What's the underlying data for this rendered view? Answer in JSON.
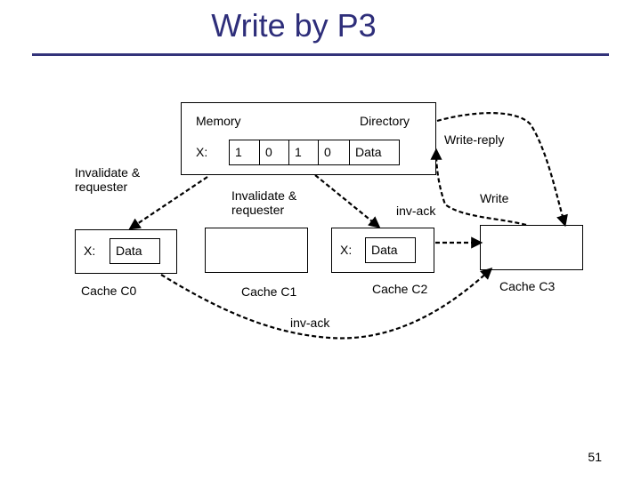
{
  "slide": {
    "title": "Write by P3",
    "page_number": "51",
    "title_color": "#2e2e7a",
    "rule_color": "#33337a"
  },
  "memory": {
    "label": "Memory",
    "directory_label": "Directory",
    "row_label": "X:",
    "directory_bits": [
      "1",
      "0",
      "1",
      "0"
    ],
    "data_label": "Data"
  },
  "caches": [
    {
      "name": "Cache C0",
      "row_label": "X:",
      "data_label": "Data"
    },
    {
      "name": "Cache C1"
    },
    {
      "name": "Cache C2",
      "row_label": "X:",
      "data_label": "Data"
    },
    {
      "name": "Cache C3"
    }
  ],
  "messages": {
    "invalidate_c0": "Invalidate &\nrequester",
    "invalidate_c2": "Invalidate &\nrequester",
    "inv_ack_c2": "inv-ack",
    "inv_ack_c0": "inv-ack",
    "write": "Write",
    "write_reply": "Write-reply"
  }
}
